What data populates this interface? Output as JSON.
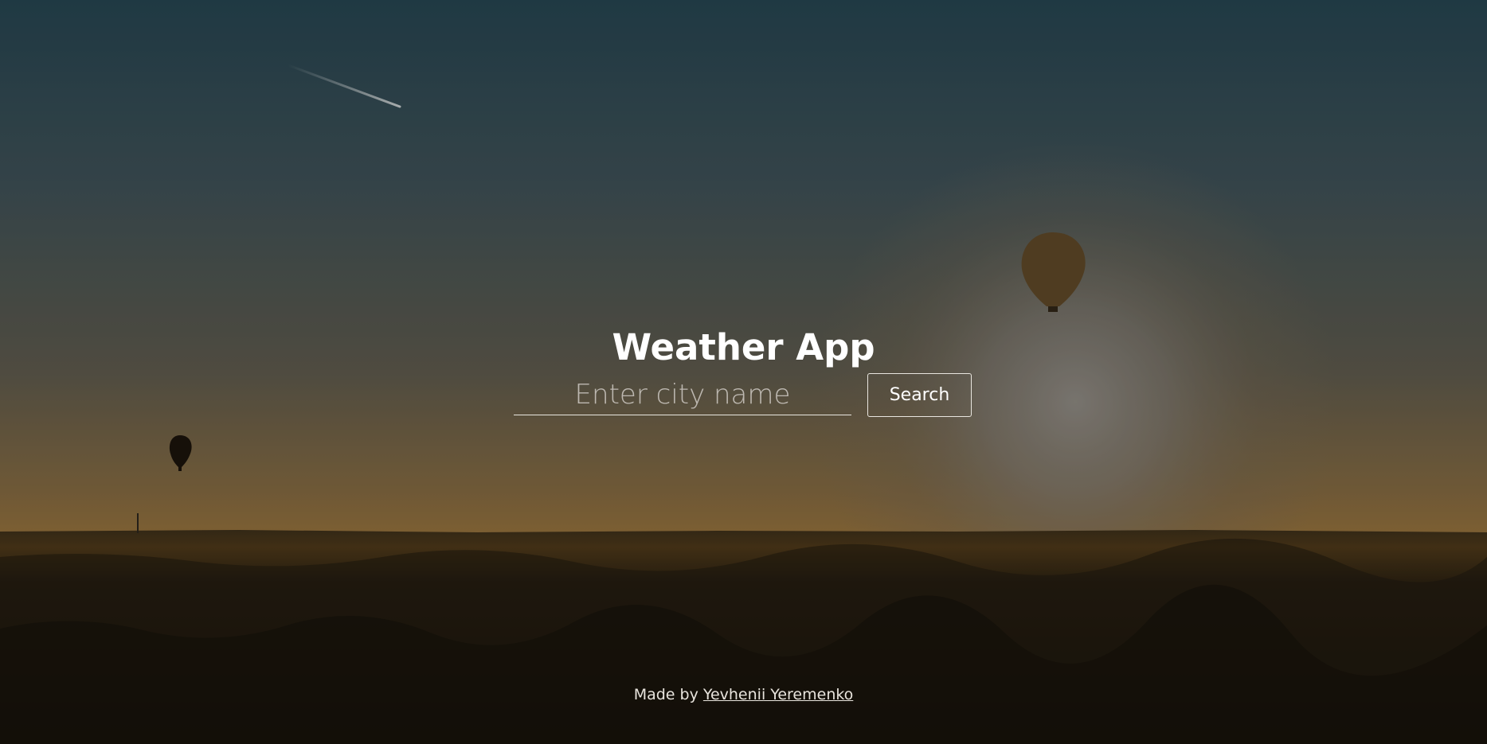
{
  "app": {
    "title": "Weather App"
  },
  "search": {
    "placeholder": "Enter city name",
    "value": "",
    "button_label": "Search"
  },
  "footer": {
    "prefix": "Made by",
    "author_name": "Yevhenii Yeremenko"
  },
  "theme": {
    "text_color": "#ffffff",
    "sky_top": "#26404c",
    "sky_horizon": "#8a6a3c",
    "forest": "#1d170e"
  }
}
